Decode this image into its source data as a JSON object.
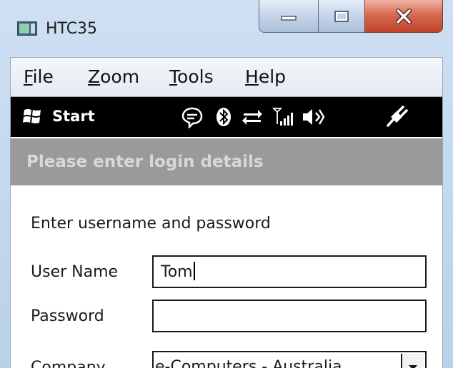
{
  "window": {
    "title": "HTC35"
  },
  "menubar": {
    "items": [
      {
        "label": "File"
      },
      {
        "label": "Zoom"
      },
      {
        "label": "Tools"
      },
      {
        "label": "Help"
      }
    ]
  },
  "taskbar": {
    "start_label": "Start",
    "tray_icons": [
      "message-icon",
      "bluetooth-icon",
      "connectivity-icon",
      "signal-icon",
      "volume-icon",
      "battery-charging-icon"
    ]
  },
  "header": {
    "text": "Please enter login details"
  },
  "form": {
    "instruction": "Enter username and password",
    "username_label": "User Name",
    "username_value": "Tom",
    "password_label": "Password",
    "password_value": "",
    "company_label": "Company",
    "company_value": "e-Computers - Australia"
  }
}
